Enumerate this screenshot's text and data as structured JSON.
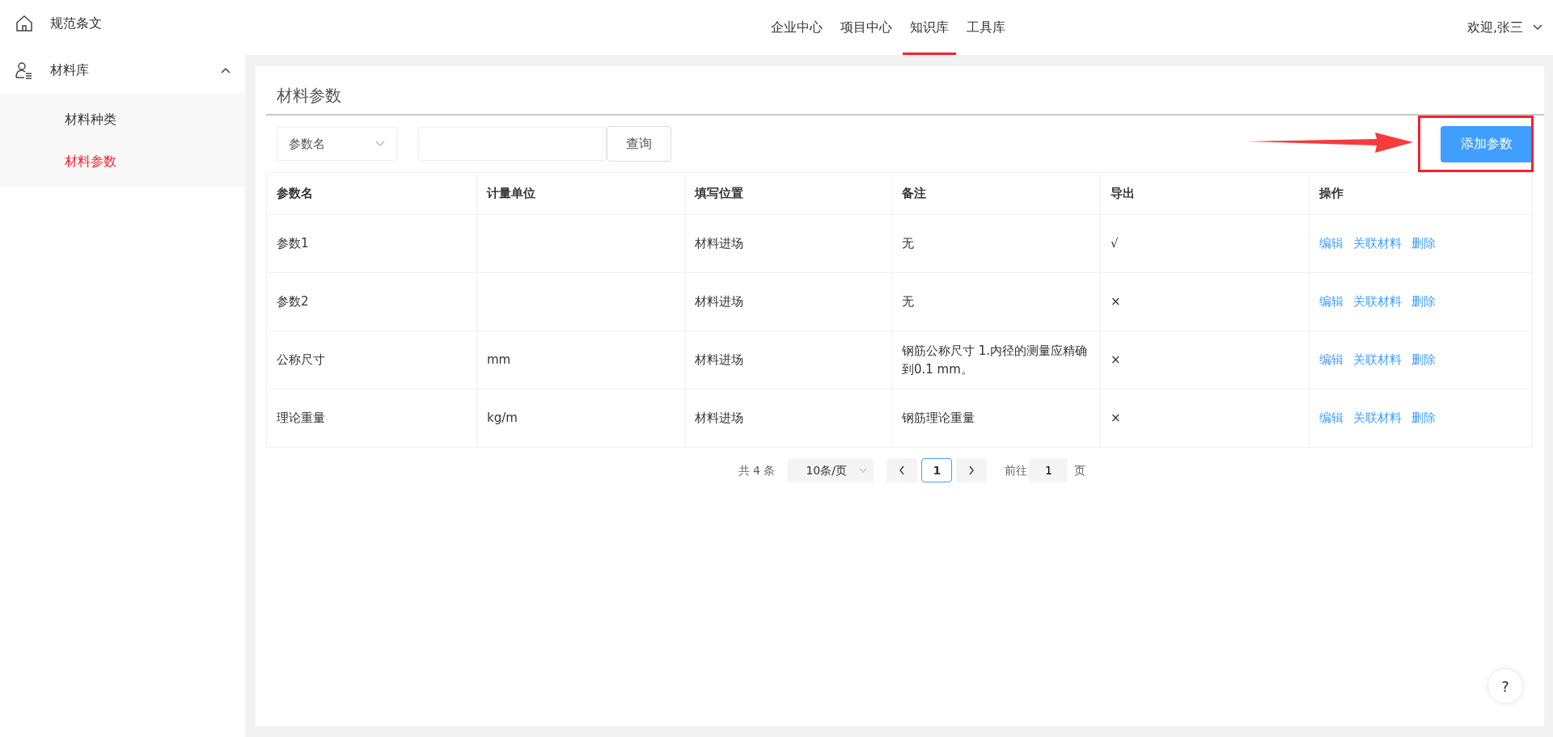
{
  "sidebar": {
    "items": [
      {
        "label": "规范条文"
      },
      {
        "label": "材料库",
        "expanded": true,
        "children": [
          {
            "label": "材料种类",
            "selected": false
          },
          {
            "label": "材料参数",
            "selected": true
          }
        ]
      }
    ]
  },
  "top_nav": {
    "tabs": [
      {
        "label": "企业中心",
        "selected": false
      },
      {
        "label": "项目中心",
        "selected": false
      },
      {
        "label": "知识库",
        "selected": true
      },
      {
        "label": "工具库",
        "selected": false
      }
    ],
    "user": "欢迎,张三"
  },
  "page": {
    "title": "材料参数",
    "filter": {
      "field_select": "参数名",
      "query_button": "查询"
    },
    "add_button": "添加参数",
    "table": {
      "columns": [
        "参数名",
        "计量单位",
        "填写位置",
        "备注",
        "导出",
        "操作"
      ],
      "rows": [
        {
          "cells": [
            "参数1",
            "",
            "材料进场",
            "无",
            "√"
          ],
          "actions": [
            "编辑",
            "关联材料",
            "删除"
          ]
        },
        {
          "cells": [
            "参数2",
            "",
            "材料进场",
            "无",
            "×"
          ],
          "actions": [
            "编辑",
            "关联材料",
            "删除"
          ]
        },
        {
          "cells": [
            "公称尺寸",
            "mm",
            "材料进场",
            "钢筋公称尺寸 1.内径的测量应精确到0.1 mm。",
            "×"
          ],
          "actions": [
            "编辑",
            "关联材料",
            "删除"
          ]
        },
        {
          "cells": [
            "理论重量",
            "kg/m",
            "材料进场",
            "钢筋理论重量",
            "×"
          ],
          "actions": [
            "编辑",
            "关联材料",
            "删除"
          ]
        }
      ]
    },
    "pagination": {
      "total": "共 4 条",
      "page_size": "10条/页",
      "pages": [
        {
          "label": "1",
          "selected": true
        }
      ],
      "goto_label": "前往",
      "goto_value": "1",
      "goto_suffix": "页"
    }
  },
  "help_button": "?"
}
